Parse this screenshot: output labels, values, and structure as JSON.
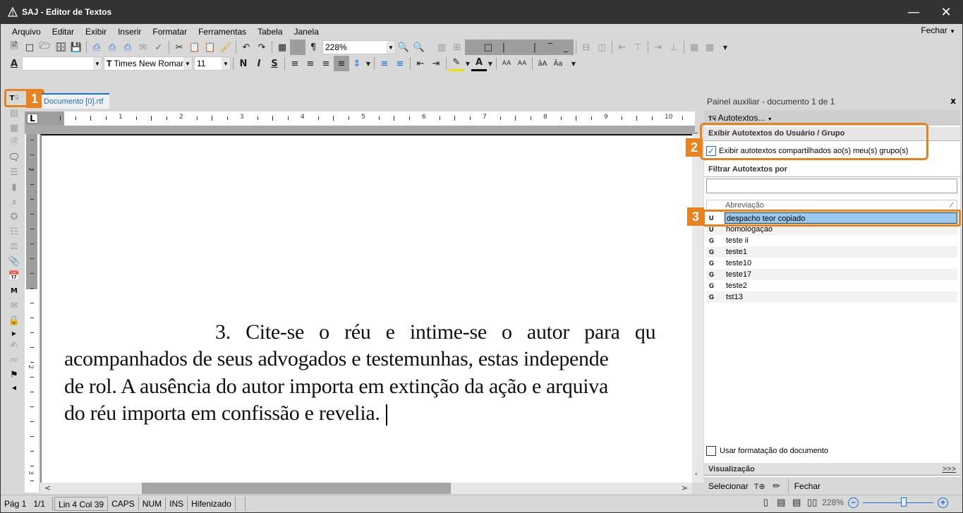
{
  "window": {
    "title": "SAJ - Editor de Textos",
    "minimize_icon": "minimize-icon",
    "close_icon": "close-icon"
  },
  "menu": {
    "items": [
      {
        "label": "Arquivo"
      },
      {
        "label": "Editar"
      },
      {
        "label": "Exibir"
      },
      {
        "label": "Inserir"
      },
      {
        "label": "Formatar"
      },
      {
        "label": "Ferramentas"
      },
      {
        "label": "Tabela"
      },
      {
        "label": "Janela"
      }
    ],
    "close_label": "Fechar"
  },
  "toolbar": {
    "zoom_value": "228%",
    "style_value": "",
    "font_value": "Times New Roman",
    "font_size_value": "11",
    "bold_label": "N",
    "italic_label": "I",
    "underline_label": "S"
  },
  "annotations": {
    "badge1": "1",
    "badge2": "2",
    "badge3": "3"
  },
  "document": {
    "tab_label": "Documento [0].rtf",
    "ruler_numbers": [
      "1",
      "2",
      "3",
      "4",
      "5",
      "6",
      "7",
      "8",
      "9",
      "10"
    ],
    "vruler_numbers": [
      "2",
      "1",
      "1",
      "2",
      "3"
    ],
    "lines": [
      "3. Cite-se o réu e intime-se o autor para qu",
      "acompanhados de seus advogados e testemunhas, estas independe",
      "de rol. A ausência do autor importa em extinção da ação e arquiva",
      "do réu importa em confissão e revelia."
    ]
  },
  "panel": {
    "title": "Painel auxiliar - documento 1 de 1",
    "close_label": "x",
    "autotextos_label": "Autotextos...",
    "section_user_group": "Exibir Autotextos do Usuário / Grupo",
    "shared_checkbox_label": "Exibir autotextos compartilhados ao(s) meu(s) grupo(s)",
    "shared_checked": true,
    "filter_section": "Filtrar Autotextos por",
    "filter_value": "",
    "list_header": "Abreviação",
    "items": [
      {
        "type": "U",
        "label": "despacho teor copiado",
        "selected": true
      },
      {
        "type": "U",
        "label": "homologação",
        "selected": false
      },
      {
        "type": "G",
        "label": "teste ii",
        "selected": false
      },
      {
        "type": "G",
        "label": "teste1",
        "selected": false
      },
      {
        "type": "G",
        "label": "teste10",
        "selected": false
      },
      {
        "type": "G",
        "label": "teste17",
        "selected": false
      },
      {
        "type": "G",
        "label": "teste2",
        "selected": false
      },
      {
        "type": "G",
        "label": "tst13",
        "selected": false
      }
    ],
    "use_format_label": "Usar formatação do documento",
    "use_format_checked": false,
    "visualizacao_label": "Visualização",
    "more_label": ">>>",
    "select_label": "Selecionar",
    "close_button_label": "Fechar"
  },
  "status": {
    "page": "Pág 1",
    "pages": "1/1",
    "position": "Lin 4  Col 39",
    "caps": "CAPS",
    "num": "NUM",
    "ins": "INS",
    "hyphen": "Hifenizado",
    "zoom": "228%",
    "zoom_fraction": 0.58
  },
  "colors": {
    "accent": "#1a6fd6",
    "highlight": "#e8821e",
    "selection": "#99c9ef",
    "titlebar": "#333333"
  }
}
